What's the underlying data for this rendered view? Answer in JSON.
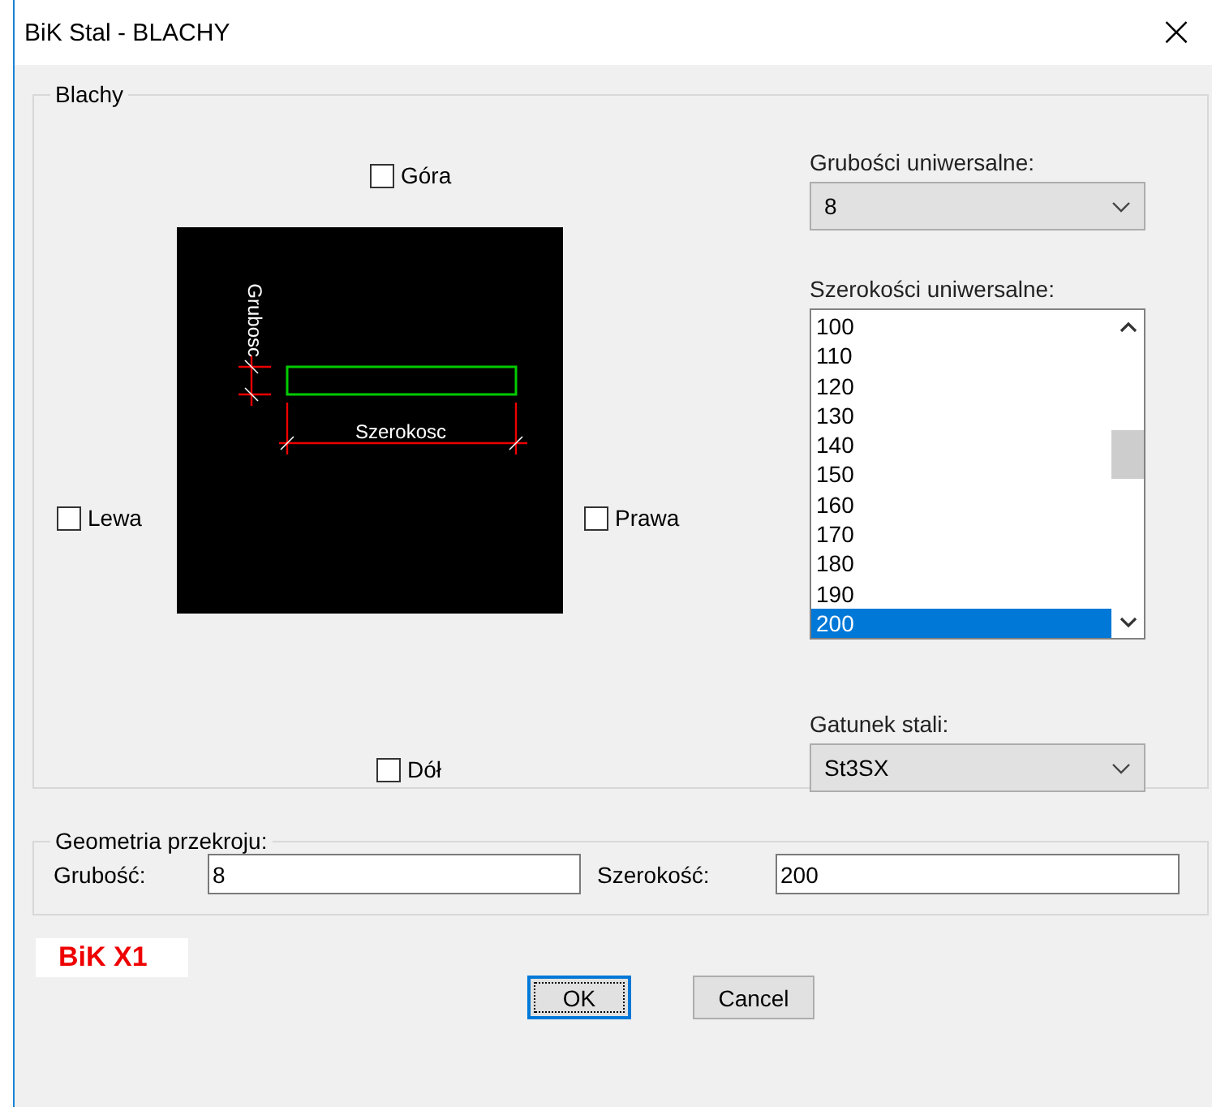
{
  "window": {
    "title": "BiK Stal - BLACHY",
    "close": "×"
  },
  "blachy": {
    "title": "Blachy",
    "sides": [
      {
        "label": "Góra",
        "checked": false
      },
      {
        "label": "Lewa",
        "checked": false
      },
      {
        "label": "Prawa",
        "checked": false
      },
      {
        "label": "Dół",
        "checked": false
      }
    ],
    "preview": {
      "thickness_label": "Grubosc",
      "width_label": "Szerokosc"
    },
    "thickness_combo": {
      "label": "Grubości uniwersalne:",
      "value": "8"
    },
    "widths_list": {
      "label": "Szerokości uniwersalne:",
      "items": [
        {
          "text": "100",
          "selected": false
        },
        {
          "text": "110",
          "selected": false
        },
        {
          "text": "120",
          "selected": false
        },
        {
          "text": "130",
          "selected": false
        },
        {
          "text": "140",
          "selected": false
        },
        {
          "text": "150",
          "selected": false
        },
        {
          "text": "160",
          "selected": false
        },
        {
          "text": "170",
          "selected": false
        },
        {
          "text": "180",
          "selected": false
        },
        {
          "text": "190",
          "selected": false
        },
        {
          "text": "200",
          "selected": true
        }
      ]
    },
    "grade_combo": {
      "label": "Gatunek stali:",
      "value": "St3SX"
    }
  },
  "geometry": {
    "title": "Geometria przekroju:",
    "fields": [
      {
        "label": "Grubość:",
        "value": "8"
      },
      {
        "label": "Szerokość:",
        "value": "200"
      }
    ]
  },
  "logo": "BiK X1",
  "buttons": [
    "OK",
    "Cancel"
  ]
}
